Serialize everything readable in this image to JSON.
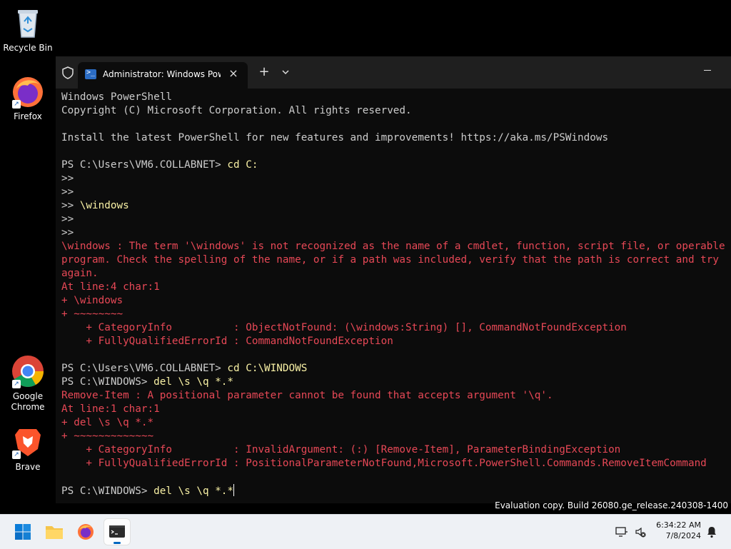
{
  "desktop": {
    "icons": [
      {
        "label": "Recycle Bin"
      },
      {
        "label": "Firefox"
      },
      {
        "label": "Google Chrome"
      },
      {
        "label": "Brave"
      }
    ]
  },
  "terminal": {
    "tab_title": "Administrator: Windows PowerShell",
    "new_tab_label": "+",
    "close_label": "×",
    "lines": [
      {
        "text": "Windows PowerShell",
        "type": "out"
      },
      {
        "text": "Copyright (C) Microsoft Corporation. All rights reserved.",
        "type": "out"
      },
      {
        "text": "",
        "type": "out"
      },
      {
        "text": "Install the latest PowerShell for new features and improvements! https://aka.ms/PSWindows",
        "type": "out"
      },
      {
        "text": "",
        "type": "out"
      },
      {
        "text": "PS C:\\Users\\VM6.COLLABNET> ",
        "type": "prompt",
        "cmd": "cd C:"
      },
      {
        "text": ">>",
        "type": "out"
      },
      {
        "text": ">>",
        "type": "out"
      },
      {
        "text": ">> ",
        "type": "prompt",
        "cmd": "\\windows"
      },
      {
        "text": ">>",
        "type": "out"
      },
      {
        "text": ">>",
        "type": "out"
      },
      {
        "text": "\\windows : The term '\\windows' is not recognized as the name of a cmdlet, function, script file, or operable",
        "type": "err"
      },
      {
        "text": "program. Check the spelling of the name, or if a path was included, verify that the path is correct and try",
        "type": "err"
      },
      {
        "text": "again.",
        "type": "err"
      },
      {
        "text": "At line:4 char:1",
        "type": "err"
      },
      {
        "text": "+ \\windows",
        "type": "err"
      },
      {
        "text": "+ ~~~~~~~~",
        "type": "err"
      },
      {
        "text": "    + CategoryInfo          : ObjectNotFound: (\\windows:String) [], CommandNotFoundException",
        "type": "err"
      },
      {
        "text": "    + FullyQualifiedErrorId : CommandNotFoundException",
        "type": "err"
      },
      {
        "text": "",
        "type": "out"
      },
      {
        "text": "PS C:\\Users\\VM6.COLLABNET> ",
        "type": "prompt",
        "cmd": "cd C:\\WINDOWS"
      },
      {
        "text": "PS C:\\WINDOWS> ",
        "type": "prompt",
        "cmd": "del \\s \\q *.*"
      },
      {
        "text": "Remove-Item : A positional parameter cannot be found that accepts argument '\\q'.",
        "type": "err"
      },
      {
        "text": "At line:1 char:1",
        "type": "err"
      },
      {
        "text": "+ del \\s \\q *.*",
        "type": "err"
      },
      {
        "text": "+ ~~~~~~~~~~~~~",
        "type": "err"
      },
      {
        "text": "    + CategoryInfo          : InvalidArgument: (:) [Remove-Item], ParameterBindingException",
        "type": "err"
      },
      {
        "text": "    + FullyQualifiedErrorId : PositionalParameterNotFound,Microsoft.PowerShell.Commands.RemoveItemCommand",
        "type": "err"
      },
      {
        "text": "",
        "type": "out"
      },
      {
        "text": "PS C:\\WINDOWS> ",
        "type": "prompt",
        "cmd": "del \\s \\q *.*",
        "cursor": true
      }
    ]
  },
  "watermark": "Evaluation copy. Build 26080.ge_release.240308-1400",
  "taskbar": {
    "clock_time": "6:34:22 AM",
    "clock_date": "7/8/2024"
  },
  "colors": {
    "error": "#e74856",
    "command": "#f9f1a5",
    "output": "#cccccc",
    "accent": "#0067c0"
  }
}
